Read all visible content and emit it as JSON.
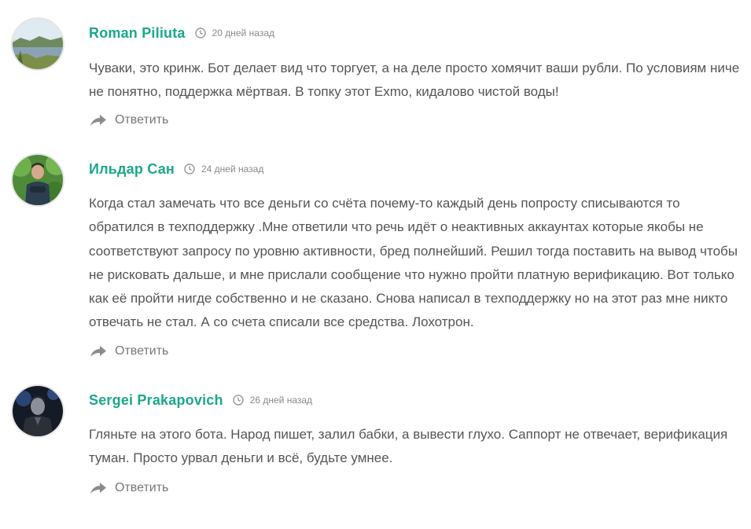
{
  "comments": [
    {
      "author": "Roman Piliuta",
      "time": "20 дней назад",
      "text": "Чуваки, это кринж. Бот делает вид что торгует, а на деле просто хомячит ваши рубли. По условиям ниче не понятно, поддержка мёртвая. В топку этот Exmo, кидалово чистой воды!",
      "reply_label": "Ответить",
      "avatar_icon": "landscape-avatar"
    },
    {
      "author": "Ильдар Сан",
      "time": "24 дней назад",
      "text": "Когда стал замечать что все деньги со счёта почему-то каждый день попросту списываются то обратился в техподдержку .Мне ответили что речь идёт о неактивных аккаунтах которые якобы не соответствуют запросу по уровню активности, бред полнейший. Решил тогда поставить на вывод чтобы не рисковать дальше, и мне прислали сообщение что нужно пройти платную верификацию. Вот только как её пройти нигде собственно и не сказано. Снова написал в техподдержку но на этот раз мне никто отвечать не стал. А со счета списали все средства. Лохотрон.",
      "reply_label": "Ответить",
      "avatar_icon": "person-in-forest-avatar"
    },
    {
      "author": "Sergei Prakapovich",
      "time": "26 дней назад",
      "text": "Гляньте на этого бота. Народ пишет, залил бабки, а вывести глухо. Саппорт не отвечает, верификация туман. Просто урвал деньги и всё, будьте умнее.",
      "reply_label": "Ответить",
      "avatar_icon": "dark-portrait-avatar"
    }
  ],
  "colors": {
    "author": "#1aa889",
    "text": "#555555",
    "meta": "#888888",
    "reply": "#777777"
  }
}
